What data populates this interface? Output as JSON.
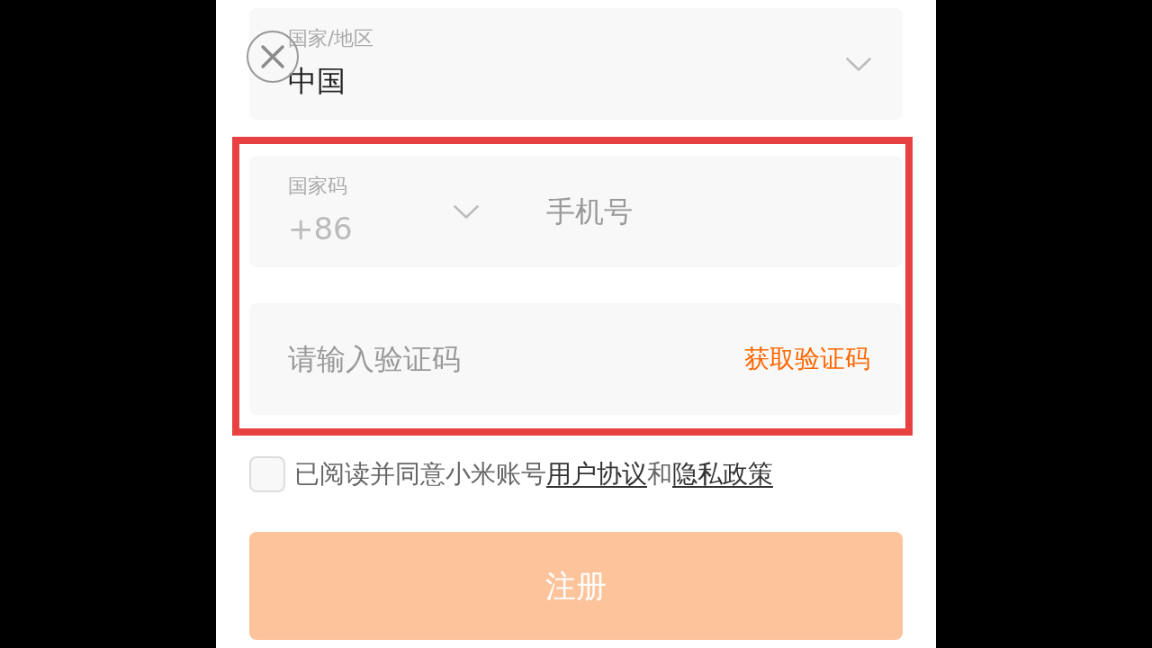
{
  "region": {
    "label": "国家/地区",
    "value": "中国"
  },
  "phone": {
    "country_code_label": "国家码",
    "country_code": "+86",
    "placeholder": "手机号"
  },
  "verification": {
    "placeholder": "请输入验证码",
    "get_code_button": "获取验证码"
  },
  "agreement": {
    "checked": false,
    "parts": [
      {
        "kind": "text",
        "text": "已阅读并同意小米账号"
      },
      {
        "kind": "link",
        "text": "用户协议"
      },
      {
        "kind": "text",
        "text": "和"
      },
      {
        "kind": "link",
        "text": "隐私政策"
      }
    ]
  },
  "submit_button": {
    "label": "注册",
    "disabled": true
  }
}
